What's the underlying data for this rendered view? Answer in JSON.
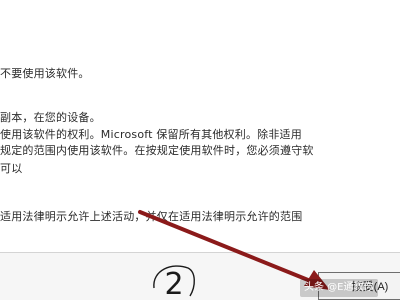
{
  "license_text": {
    "line1": "不要使用该软件。",
    "line2": "副本，在您的设备。",
    "line3": "使用该软件的权利。Microsoft 保留所有其他权利。除非适用",
    "line4": "规定的范围内使用该软件。在按规定使用软件时，您必须遵守软",
    "line5": "可以",
    "line6": "适用法律明示允许上述活动，并仅在适用法律明示允许的范围"
  },
  "annotation": {
    "circled_number": "2"
  },
  "buttons": {
    "accept_label": "接受(A)"
  },
  "watermark": {
    "text": "头条 @E通教你"
  },
  "colors": {
    "arrow": "#8b1a1a",
    "annotation": "#1a1a1a"
  }
}
